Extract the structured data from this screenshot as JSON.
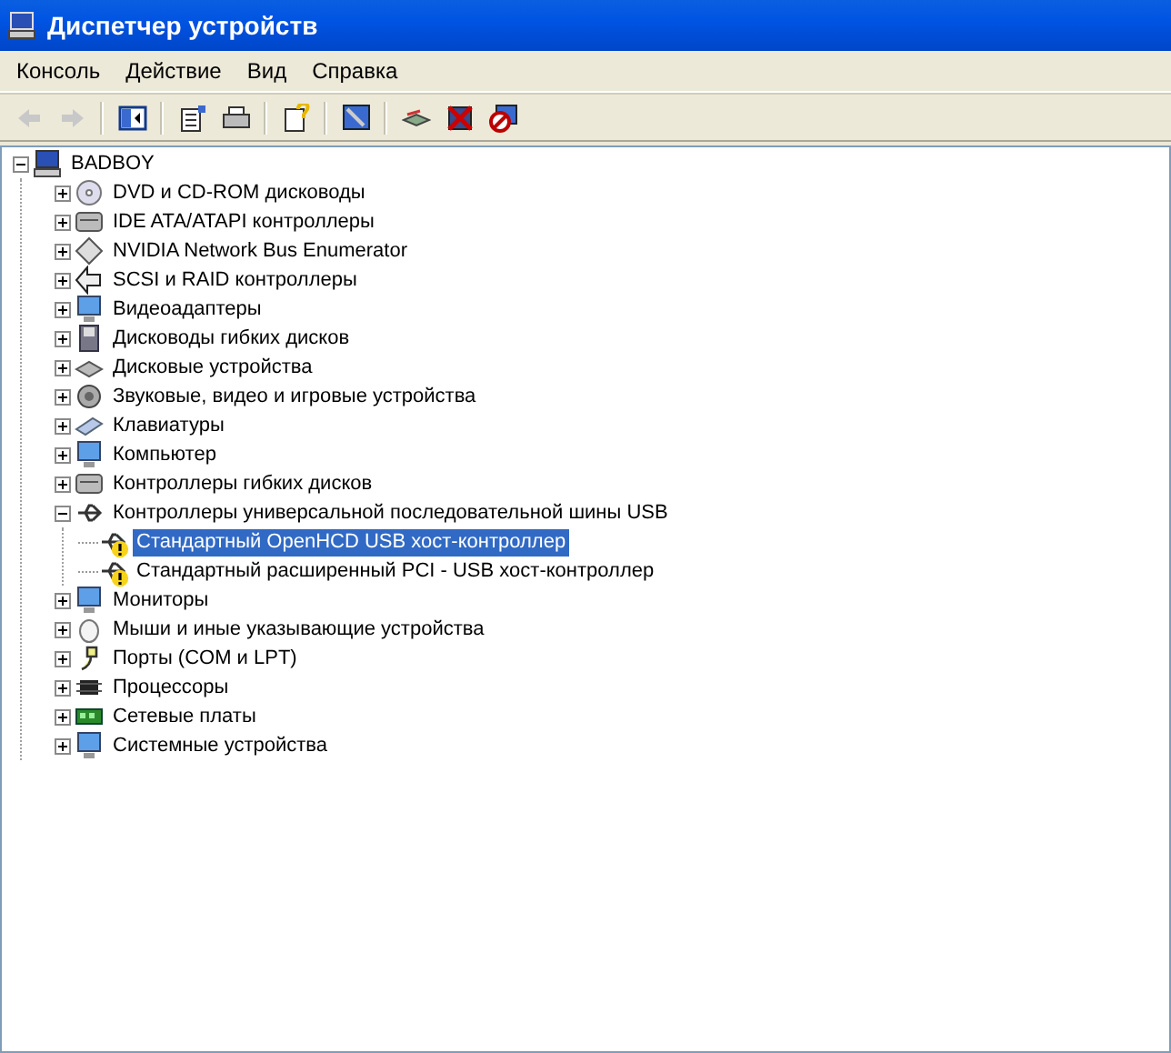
{
  "window": {
    "title": "Диспетчер устройств"
  },
  "menu": [
    "Консоль",
    "Действие",
    "Вид",
    "Справка"
  ],
  "toolbar": [
    {
      "kind": "back",
      "disabled": true
    },
    {
      "kind": "forward",
      "disabled": true
    },
    {
      "kind": "panel"
    },
    {
      "kind": "properties"
    },
    {
      "kind": "print"
    },
    {
      "kind": "help"
    },
    {
      "kind": "scan"
    },
    {
      "kind": "update"
    },
    {
      "kind": "uninstall"
    },
    {
      "kind": "disable"
    }
  ],
  "tree": [
    {
      "label": "BADBOY",
      "kind": "computer",
      "expanded": true,
      "selected": false,
      "children": [
        {
          "label": "DVD и CD-ROM дисководы",
          "kind": "cd",
          "expanded": false,
          "selected": false
        },
        {
          "label": "IDE ATA/ATAPI контроллеры",
          "kind": "controller",
          "expanded": false,
          "selected": false
        },
        {
          "label": "NVIDIA Network Bus Enumerator",
          "kind": "diamond",
          "expanded": false,
          "selected": false
        },
        {
          "label": "SCSI и RAID контроллеры",
          "kind": "scsi",
          "expanded": false,
          "selected": false
        },
        {
          "label": "Видеоадаптеры",
          "kind": "monitor",
          "expanded": false,
          "selected": false
        },
        {
          "label": "Дисководы гибких дисков",
          "kind": "floppy",
          "expanded": false,
          "selected": false
        },
        {
          "label": "Дисковые устройства",
          "kind": "disk",
          "expanded": false,
          "selected": false
        },
        {
          "label": "Звуковые, видео и игровые устройства",
          "kind": "sound",
          "expanded": false,
          "selected": false
        },
        {
          "label": "Клавиатуры",
          "kind": "keyboard",
          "expanded": false,
          "selected": false
        },
        {
          "label": "Компьютер",
          "kind": "monitor",
          "expanded": false,
          "selected": false
        },
        {
          "label": "Контроллеры гибких дисков",
          "kind": "controller",
          "expanded": false,
          "selected": false
        },
        {
          "label": "Контроллеры универсальной последовательной шины USB",
          "kind": "usb",
          "expanded": true,
          "selected": false,
          "children": [
            {
              "label": "Стандартный OpenHCD USB хост-контроллер",
              "kind": "usb",
              "problem": true,
              "selected": true
            },
            {
              "label": "Стандартный расширенный PCI - USB хост-контроллер",
              "kind": "usb",
              "problem": true,
              "selected": false
            }
          ]
        },
        {
          "label": "Мониторы",
          "kind": "monitor",
          "expanded": false,
          "selected": false
        },
        {
          "label": "Мыши и иные указывающие устройства",
          "kind": "mouse",
          "expanded": false,
          "selected": false
        },
        {
          "label": "Порты (COM и LPT)",
          "kind": "port",
          "expanded": false,
          "selected": false
        },
        {
          "label": "Процессоры",
          "kind": "cpu",
          "expanded": false,
          "selected": false
        },
        {
          "label": "Сетевые платы",
          "kind": "network",
          "expanded": false,
          "selected": false
        },
        {
          "label": "Системные устройства",
          "kind": "monitor",
          "expanded": false,
          "selected": false
        }
      ]
    }
  ]
}
